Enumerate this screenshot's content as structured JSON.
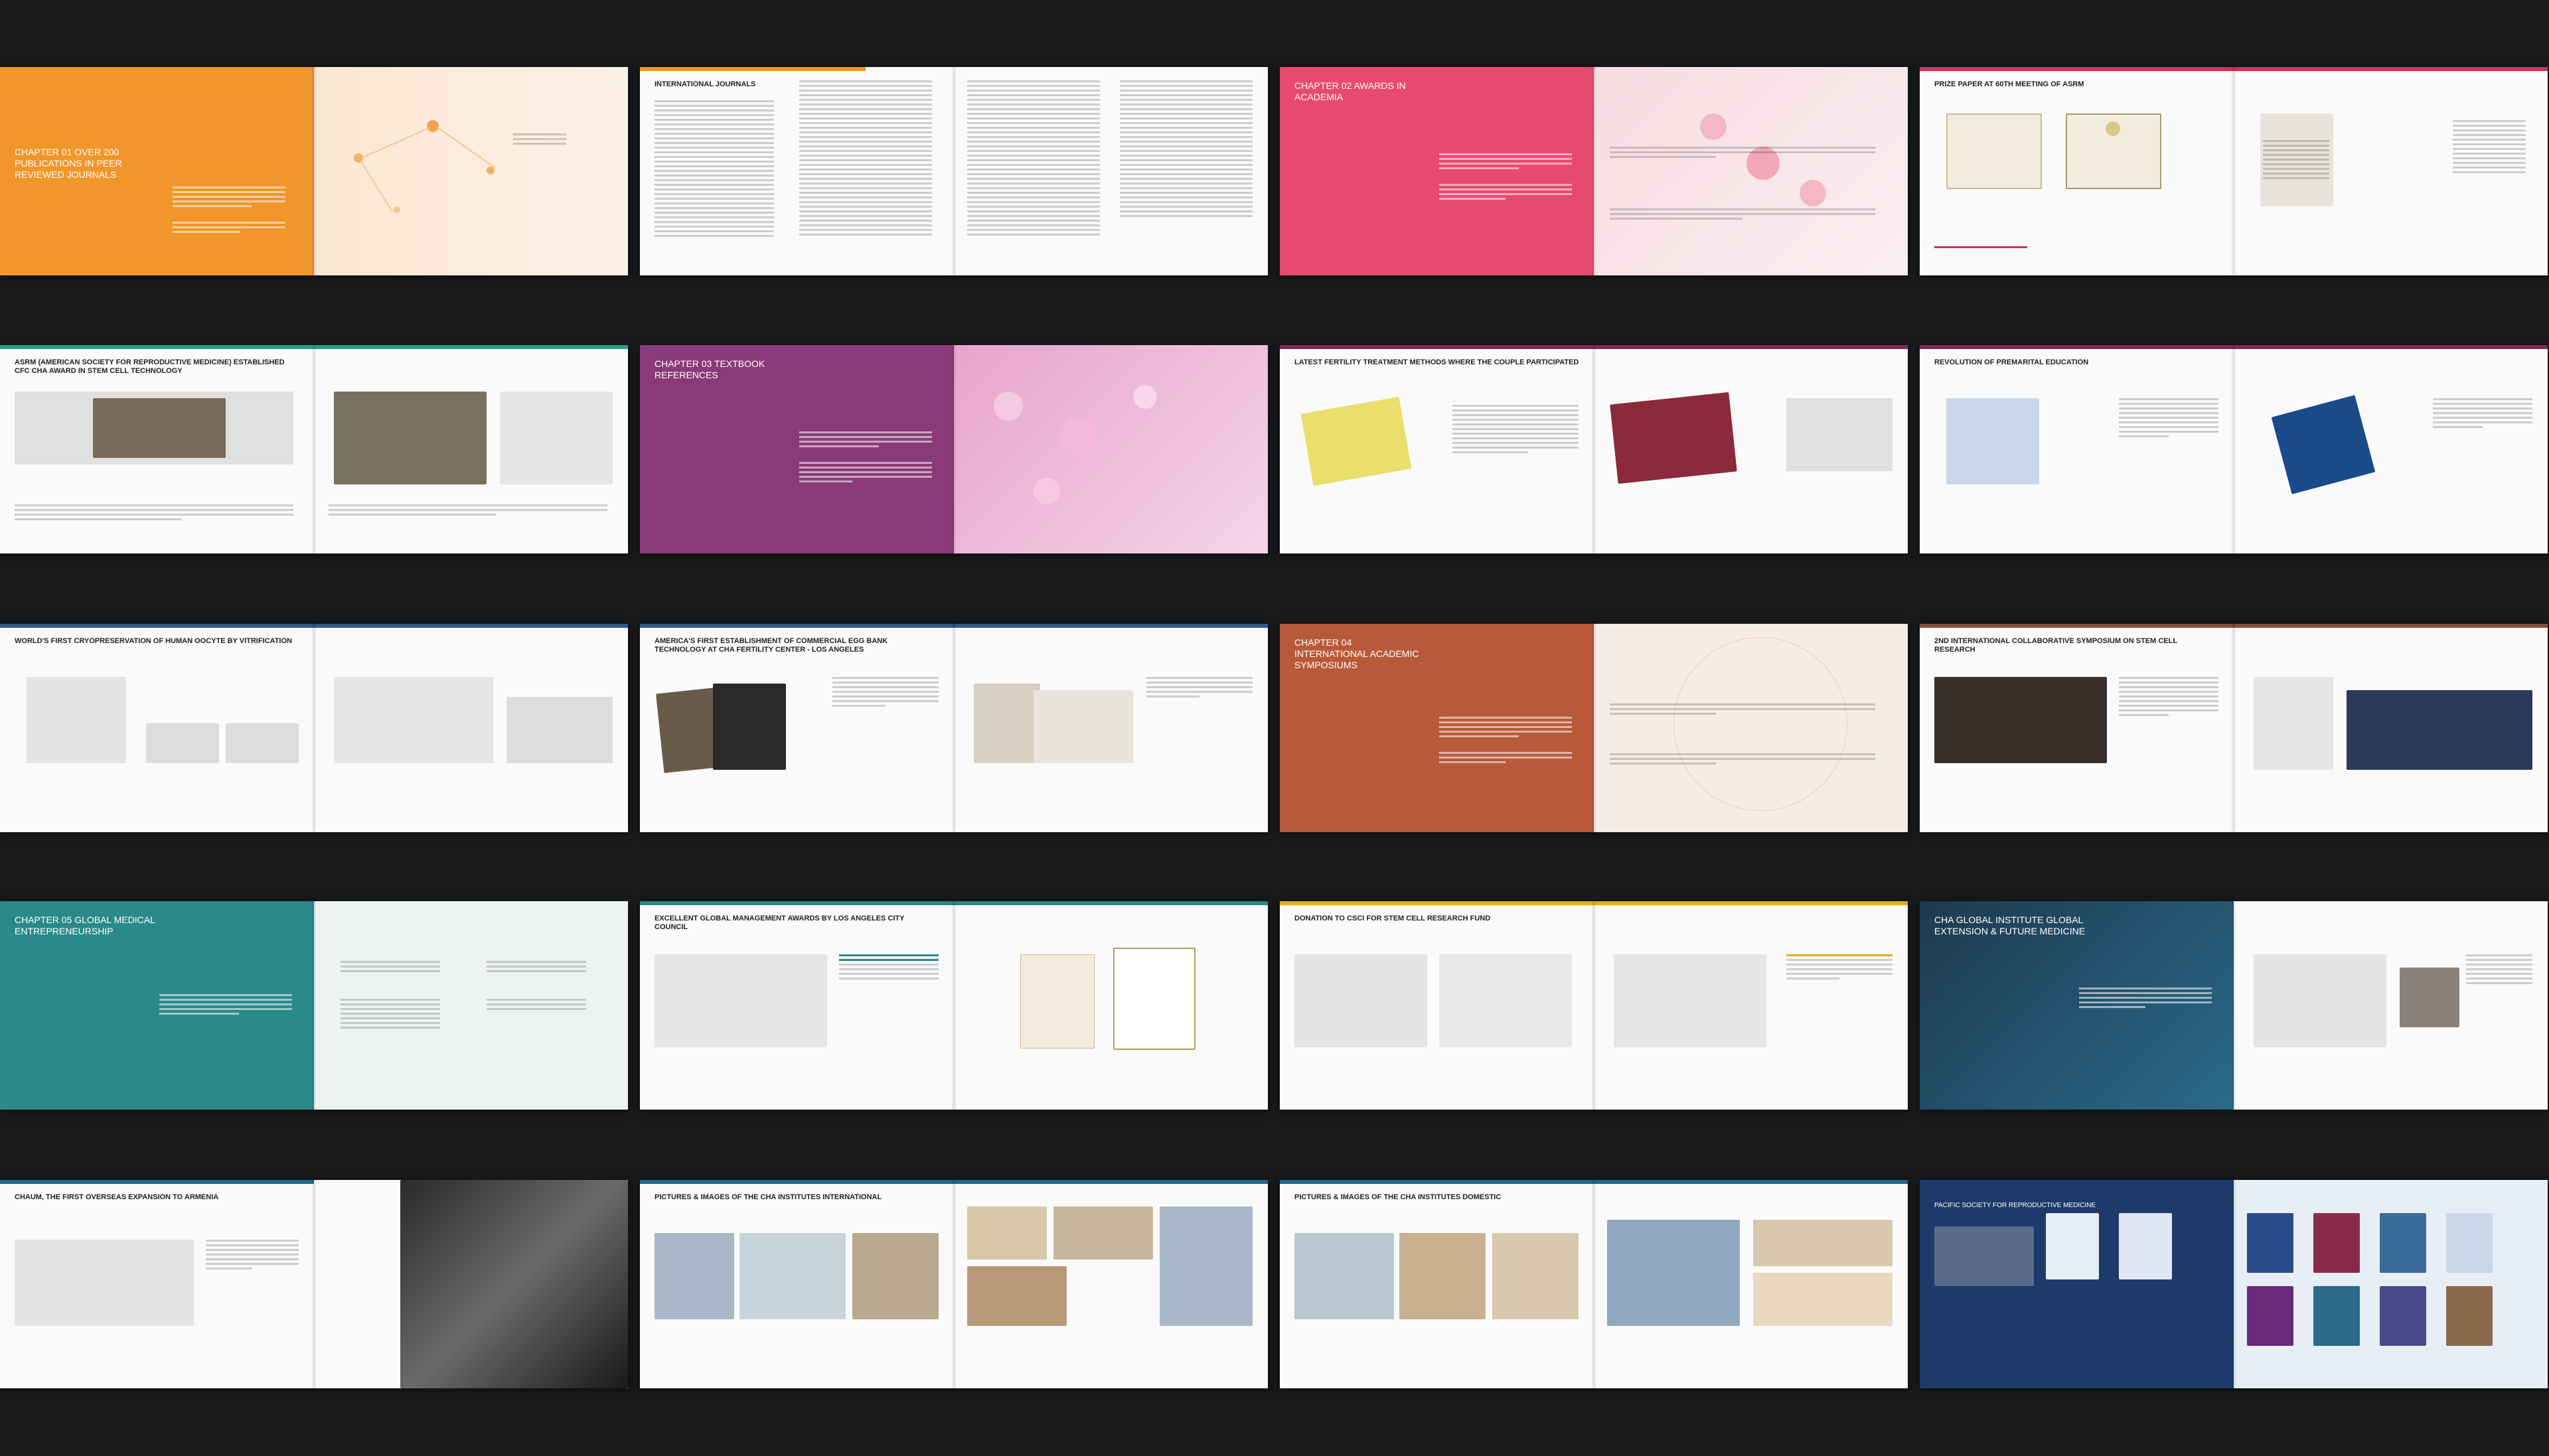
{
  "spreads": [
    {
      "title": "CHAPTER 01 OVER 200 PUBLICATIONS IN PEER REVIEWED JOURNALS",
      "accent": "#f0962a"
    },
    {
      "title": "INTERNATIONAL JOURNALS",
      "accent": "#f0962a"
    },
    {
      "title": "CHAPTER 02 AWARDS IN ACADEMIA",
      "accent": "#e84a6e"
    },
    {
      "title": "PRIZE PAPER AT 60TH MEETING OF ASRM",
      "accent": "#c8345a"
    },
    {
      "title": "ASRM (AMERICAN SOCIETY FOR REPRODUCTIVE MEDICINE) ESTABLISHED CFC CHA AWARD IN STEM CELL TECHNOLOGY",
      "accent": "#2a9d8f"
    },
    {
      "title": "CHAPTER 03 TEXTBOOK REFERENCES",
      "accent": "#8a3a78"
    },
    {
      "title": "LATEST FERTILITY TREATMENT METHODS WHERE THE COUPLE PARTICIPATED",
      "accent": "#7a2a5a"
    },
    {
      "title": "REVOLUTION OF PREMARITAL EDUCATION",
      "accent": "#7a2a5a"
    },
    {
      "title": "WORLD'S FIRST CRYOPRESERVATION OF HUMAN OOCYTE BY VITRIFICATION",
      "accent": "#2d5a8c"
    },
    {
      "title": "AMERICA'S FIRST ESTABLISHMENT OF COMMERCIAL EGG BANK TECHNOLOGY AT CHA FERTILITY CENTER - LOS ANGELES",
      "accent": "#2d5a8c"
    },
    {
      "title": "CHAPTER 04 INTERNATIONAL ACADEMIC SYMPOSIUMS",
      "accent": "#b85a3a"
    },
    {
      "title": "2ND INTERNATIONAL COLLABORATIVE SYMPOSIUM ON STEM CELL RESEARCH",
      "accent": "#8a4a3a"
    },
    {
      "title": "CHAPTER 05 GLOBAL MEDICAL ENTREPRENEURSHIP",
      "accent": "#2a8a8a"
    },
    {
      "title": "EXCELLENT GLOBAL MANAGEMENT AWARDS BY LOS ANGELES CITY COUNCIL",
      "accent": "#2a8a8a"
    },
    {
      "title": "DONATION TO CSCI FOR STEM CELL RESEARCH FUND",
      "accent": "#e8a82a"
    },
    {
      "title": "CHA GLOBAL INSTITUTE GLOBAL EXTENSION & FUTURE MEDICINE",
      "accent": "#1e6a8a"
    },
    {
      "title": "CHAUM, THE FIRST OVERSEAS EXPANSION TO ARMENIA",
      "accent": "#1e6a8a"
    },
    {
      "title": "PICTURES & IMAGES OF THE CHA INSTITUTES INTERNATIONAL",
      "accent": "#1e6a8a"
    },
    {
      "title": "PICTURES & IMAGES OF THE CHA INSTITUTES DOMESTIC",
      "accent": "#1e6a8a"
    },
    {
      "title": "PACIFIC SOCIETY FOR REPRODUCTIVE MEDICINE",
      "accent": "#2a4a8a"
    }
  ]
}
